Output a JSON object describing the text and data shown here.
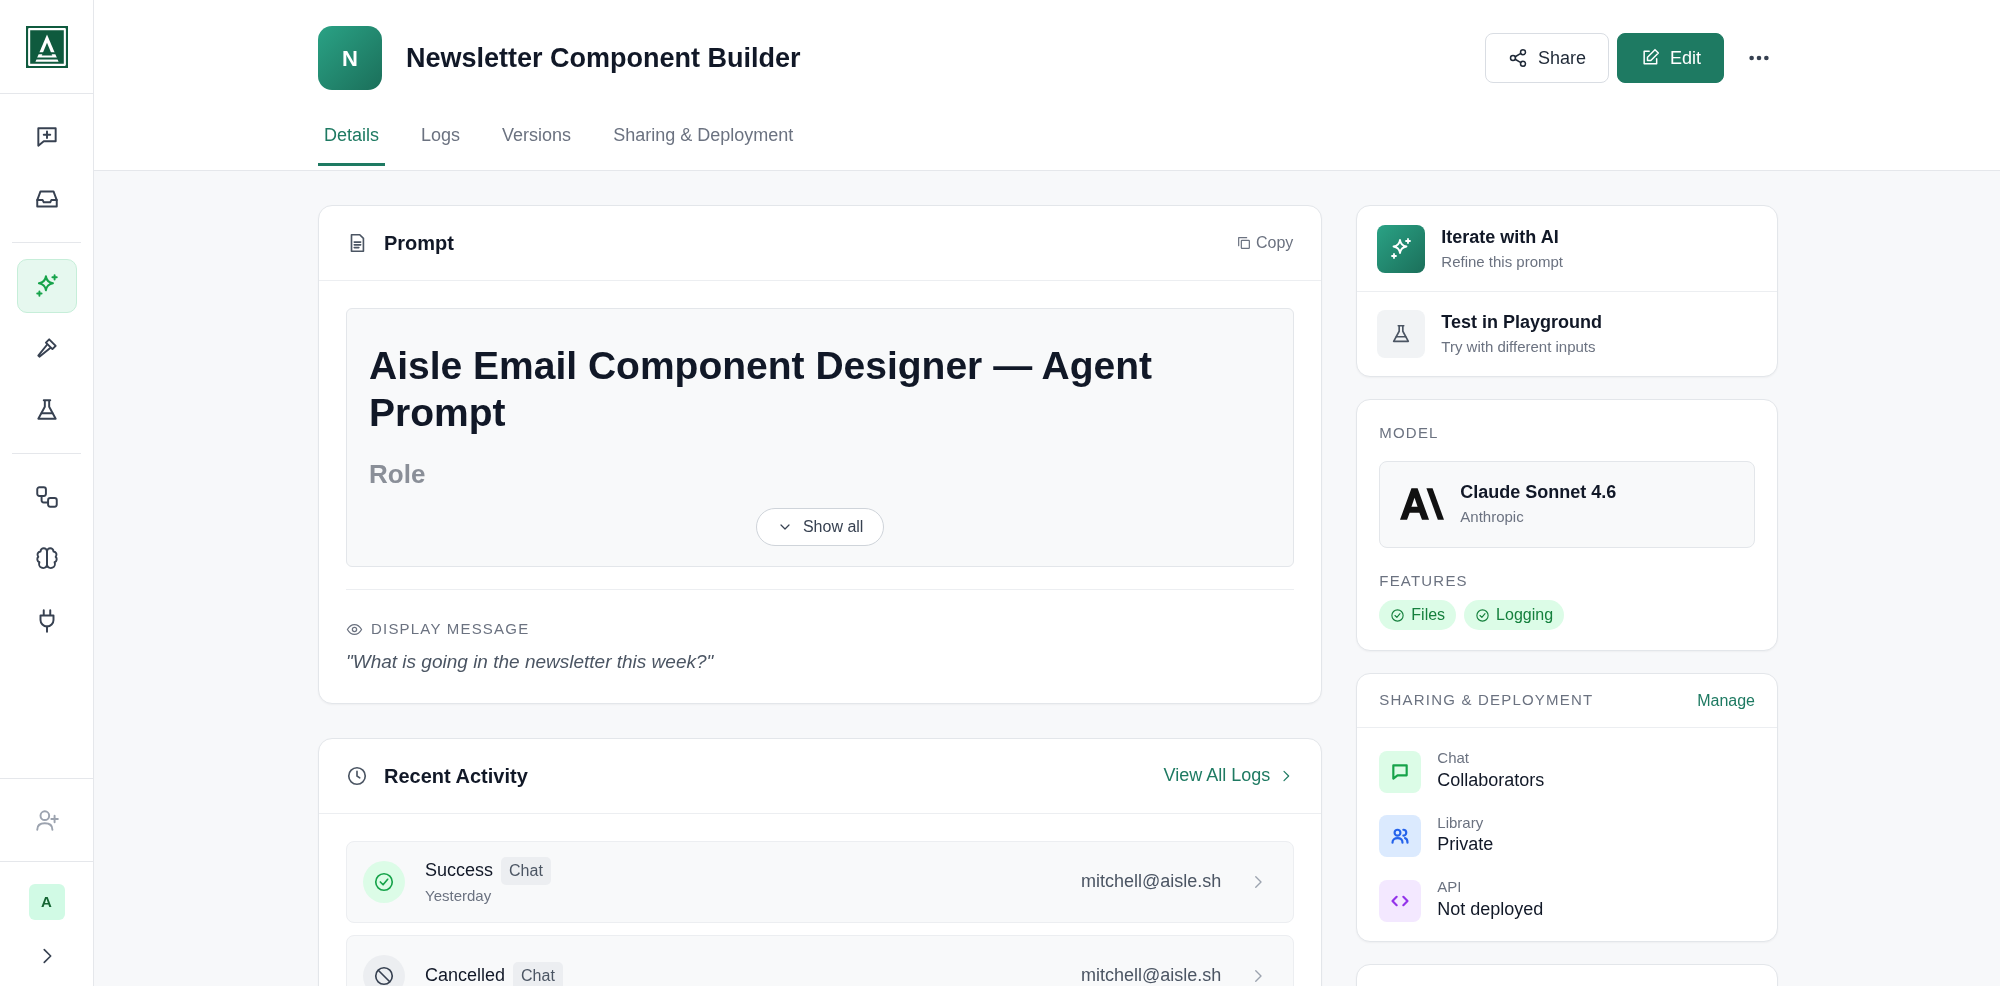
{
  "sidebar": {
    "nav_groups": [
      {
        "items": [
          {
            "selected": false
          },
          {
            "selected": false
          }
        ]
      },
      {
        "items": [
          {
            "selected": true
          },
          {
            "selected": false
          },
          {
            "selected": false
          }
        ]
      },
      {
        "items": [
          {
            "selected": false
          },
          {
            "selected": false
          },
          {
            "selected": false
          }
        ]
      }
    ],
    "user_avatar": "A"
  },
  "header": {
    "avatar_letter": "N",
    "title": "Newsletter Component Builder",
    "buttons": [
      {
        "label": "Share",
        "kind": "secondary"
      },
      {
        "label": "Edit",
        "kind": "primary"
      }
    ]
  },
  "tabs": [
    {
      "label": "Details",
      "selected": true
    },
    {
      "label": "Logs",
      "selected": false
    },
    {
      "label": "Versions",
      "selected": false
    },
    {
      "label": "Sharing & Deployment",
      "selected": false
    }
  ],
  "prompt": {
    "title": "Prompt",
    "copy": "Copy",
    "heading": "Aisle Email Component Designer — Agent Prompt",
    "subheading": "Role",
    "show_all": "Show all",
    "display_label": "DISPLAY MESSAGE",
    "display_message": "\"What is going in the newsletter this week?\""
  },
  "recent_activity": {
    "title": "Recent Activity",
    "link": "View All Logs",
    "rows": [
      {
        "kind": "success",
        "status": "Success",
        "tag": "Chat",
        "time": "Yesterday",
        "user": "mitchell@aisle.sh"
      },
      {
        "kind": "cancelled",
        "status": "Cancelled",
        "tag": "Chat",
        "user": "mitchell@aisle.sh"
      }
    ]
  },
  "actions": [
    {
      "kind": "ai",
      "title": "Iterate with AI",
      "subtitle": "Refine this prompt"
    },
    {
      "kind": "playground",
      "title": "Test in Playground",
      "subtitle": "Try with different inputs"
    }
  ],
  "model": {
    "label": "MODEL",
    "name": "Claude Sonnet 4.6",
    "provider": "Anthropic",
    "features_label": "FEATURES",
    "features": [
      "Files",
      "Logging"
    ]
  },
  "sharing": {
    "title": "SHARING & DEPLOYMENT",
    "link": "Manage",
    "items": [
      {
        "kind": "chat",
        "label": "Chat",
        "value": "Collaborators",
        "color": "#16a34a"
      },
      {
        "kind": "library",
        "label": "Library",
        "value": "Private",
        "color": "#2563eb"
      },
      {
        "kind": "api",
        "label": "API",
        "value": "Not deployed",
        "color": "#9333ea"
      }
    ]
  }
}
